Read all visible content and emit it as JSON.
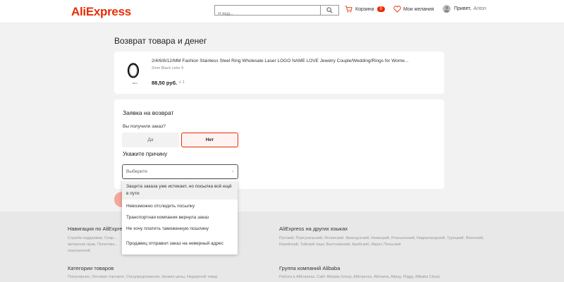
{
  "header": {
    "logo": "AliExpress",
    "search_placeholder": "Я ищу...",
    "cart_label": "Корзина",
    "cart_count": "0",
    "wishlist_label": "Мои желания",
    "greeting": "Привет,",
    "user_name": "Anton"
  },
  "page": {
    "title": "Возврат товара и денег"
  },
  "product": {
    "title": "2/4/6/8/12/MM Fashion Stainless Steel Ring Wholesale Laser LOGO NAME LOVE Jewelry Couple/Wedding/Rings for Wome...",
    "variant": "2mm Black color 9",
    "price": "88,50 руб.",
    "quantity": "x 1",
    "image_label": "2mm"
  },
  "return_form": {
    "section_title": "Заявка на возврат",
    "question": "Вы получили заказ?",
    "yes_label": "Да",
    "no_label": "Нет",
    "reason_title": "Укажите причину",
    "select_placeholder": "Выберите",
    "chevron": "›"
  },
  "dropdown": {
    "options": [
      "Защита заказа уже истекает, но посылка всё ещё в пути",
      "Невозможно отследить посылку",
      "Транспортная компания вернула заказ",
      "Не хочу платить таможенную пошлину",
      "Продавец отправил заказ на неверный адрес"
    ]
  },
  "footer": {
    "nav_title": "Навигация по AliExpress",
    "nav_text": "Служба поддержки, Спор... авторских прав, Политика... покупателей",
    "langs_title": "AliExpress на других языках",
    "langs_text": "Русский, Португальский, Испанский, Французский, Немецкий, Итальянский, Нидерландский, Турецкий, Японский, Корейский, Тайский язык, Вьетнамский, Арабский, Иврит, Польский",
    "cats_title": "Категории товаров",
    "cats_text": "Популярное, Оптовая торговля, Спецпредложения, Низкие цены, Недорогой товар",
    "group_title": "Группа компаний Alibaba",
    "group_text": "Работа в AliExpress, Сайт Alibaba Group, AliExpress, Alimama, Alipay, Fliggy, Alibaba Cloud,"
  },
  "colors": {
    "brand": "#e62e04",
    "selected_bg": "#fff3f1",
    "submit": "#f3a79a"
  }
}
